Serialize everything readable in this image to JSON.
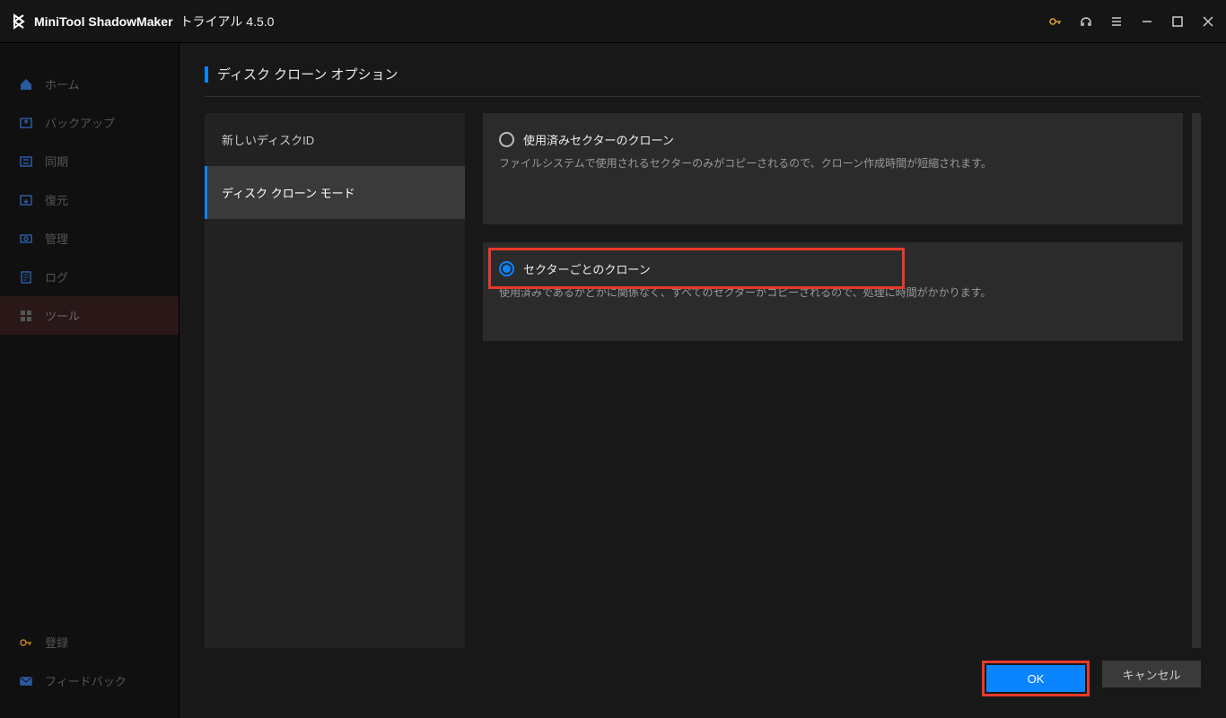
{
  "app": {
    "name": "MiniTool ShadowMaker",
    "suffix": "トライアル 4.5.0"
  },
  "sidebar": {
    "items": [
      {
        "icon": "home",
        "label": "ホーム"
      },
      {
        "icon": "backup",
        "label": "バックアップ"
      },
      {
        "icon": "sync",
        "label": "同期"
      },
      {
        "icon": "restore",
        "label": "復元"
      },
      {
        "icon": "manage",
        "label": "管理"
      },
      {
        "icon": "log",
        "label": "ログ"
      },
      {
        "icon": "tools",
        "label": "ツール"
      }
    ],
    "bottom": [
      {
        "icon": "key",
        "label": "登録"
      },
      {
        "icon": "mail",
        "label": "フィードバック"
      }
    ]
  },
  "page": {
    "title": "ディスク クローン オプション"
  },
  "tabs": [
    {
      "label": "新しいディスクID"
    },
    {
      "label": "ディスク クローン モード"
    }
  ],
  "options": [
    {
      "title": "使用済みセクターのクローン",
      "desc": "ファイルシステムで使用されるセクターのみがコピーされるので、クローン作成時間が短縮されます。",
      "selected": false
    },
    {
      "title": "セクターごとのクローン",
      "desc": "使用済みであるかどかに関係なく、すべてのセクターがコピーされるので、処理に時間がかかります。",
      "selected": true
    }
  ],
  "buttons": {
    "ok": "OK",
    "cancel": "キャンセル"
  }
}
